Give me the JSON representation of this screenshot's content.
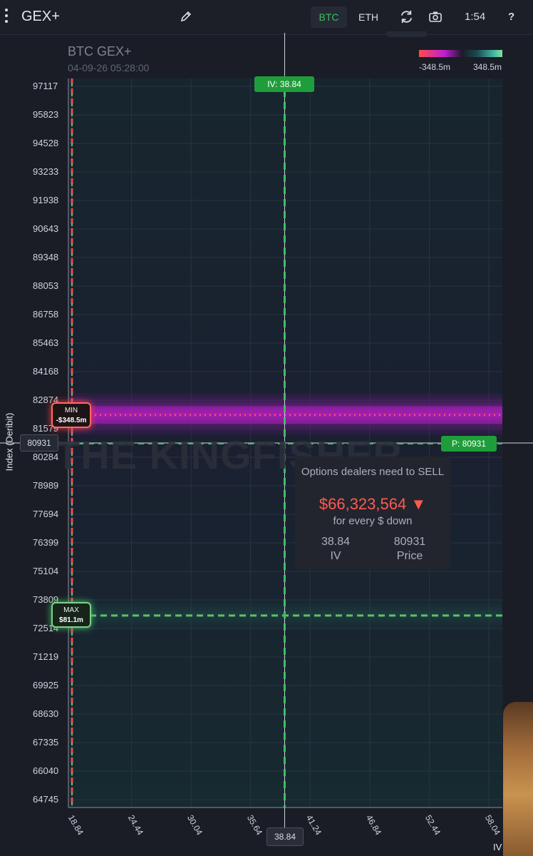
{
  "app": {
    "title": "GEX+"
  },
  "toolbar": {
    "btc_label": "BTC",
    "eth_label": "ETH",
    "time": "1:54",
    "help_label": "?"
  },
  "chart_header": {
    "title": "BTC GEX+",
    "datetime": "04-09-26 05:28:00"
  },
  "colorbar": {
    "min_label": "-348.5m",
    "max_label": "348.5m"
  },
  "cursor": {
    "iv_tag": "IV: 38.84",
    "price_tag": "P: 80931",
    "y_readout": "80931",
    "x_readout": "38.84"
  },
  "markers": {
    "min_title": "MIN",
    "min_value": "-$348.5m",
    "max_title": "MAX",
    "max_value": "$81.1m"
  },
  "watermark": "THE KINGFISHER",
  "tooltip": {
    "line1": "Options dealers need to SELL",
    "amount": "$66,323,564 ▼",
    "sub": "for every $ down",
    "iv_value": "38.84",
    "iv_label": "IV",
    "price_value": "80931",
    "price_label": "Price"
  },
  "chart_data": {
    "type": "heatmap",
    "title": "BTC GEX+",
    "xlabel": "IV",
    "ylabel": "Index (Deribit)",
    "x_ticks": [
      "18.84",
      "24.44",
      "30.04",
      "35.64",
      "41.24",
      "46.84",
      "52.44",
      "58.04"
    ],
    "y_ticks": [
      "97117",
      "95823",
      "94528",
      "93233",
      "91938",
      "90643",
      "89348",
      "88053",
      "86758",
      "85463",
      "84168",
      "82874",
      "81579",
      "80284",
      "78989",
      "77694",
      "76399",
      "75104",
      "73809",
      "72514",
      "71219",
      "69925",
      "68630",
      "67335",
      "66040",
      "64745"
    ],
    "xlim": [
      18.84,
      58.04
    ],
    "ylim": [
      64745,
      97117
    ],
    "color_range": [
      -348.5,
      348.5
    ],
    "color_unit": "m",
    "min_level": {
      "price": 82200,
      "value": -348.5
    },
    "max_level": {
      "price": 73100,
      "value": 81.1
    },
    "iv_line": 18.84,
    "cursor": {
      "iv": 38.84,
      "price": 80931
    },
    "bands": [
      {
        "price_from": 81300,
        "price_to": 83200,
        "value": -220
      },
      {
        "price_from": 81800,
        "price_to": 82600,
        "value": -348.5
      },
      {
        "price_from": 72400,
        "price_to": 73900,
        "value": 30
      }
    ]
  }
}
